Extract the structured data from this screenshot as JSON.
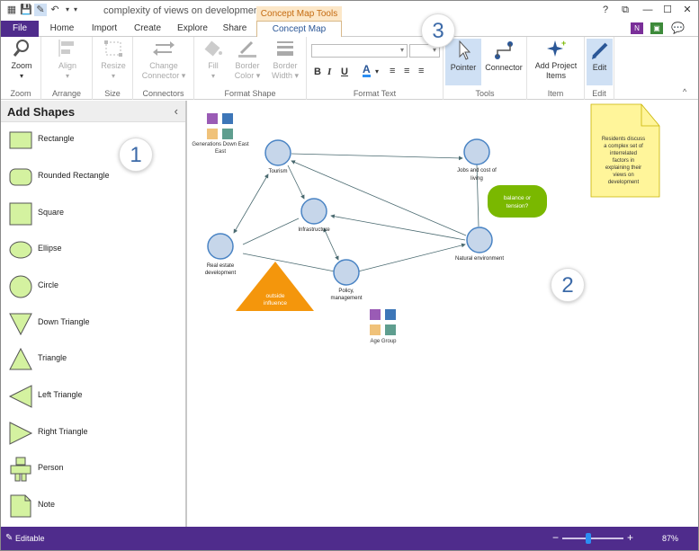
{
  "window": {
    "title": "complexity of views on development",
    "context_tab": "Concept Map Tools",
    "help": "?",
    "controls": [
      "⧉",
      "—",
      "☐",
      "✕"
    ]
  },
  "tabs": [
    {
      "label": "File"
    },
    {
      "label": "Home"
    },
    {
      "label": "Import"
    },
    {
      "label": "Create"
    },
    {
      "label": "Explore"
    },
    {
      "label": "Share"
    },
    {
      "label": "Concept Map"
    }
  ],
  "ribbon": {
    "zoom": {
      "label": "Zoom",
      "group": "Zoom"
    },
    "align": {
      "label": "Align",
      "group": "Arrange"
    },
    "resize": {
      "label": "Resize",
      "group": "Size"
    },
    "change_connector": {
      "label1": "Change",
      "label2": "Connector ▾",
      "group": "Connectors"
    },
    "fill": {
      "label": "Fill"
    },
    "border_color": {
      "label1": "Border",
      "label2": "Color ▾"
    },
    "border_width": {
      "label1": "Border",
      "label2": "Width ▾",
      "group": "Format Shape"
    },
    "format_text": {
      "group": "Format Text",
      "bold": "B",
      "italic": "I",
      "underline": "U",
      "font_color": "A"
    },
    "pointer": {
      "label": "Pointer"
    },
    "connector": {
      "label": "Connector",
      "group": "Tools"
    },
    "add_project_items": {
      "label1": "Add Project",
      "label2": "Items",
      "group": "Item"
    },
    "edit": {
      "label": "Edit",
      "group": "Edit"
    },
    "collapse": "^"
  },
  "badges": {
    "one": "1",
    "two": "2",
    "three": "3"
  },
  "sidebar": {
    "title": "Add Shapes",
    "collapse": "‹",
    "shapes": [
      {
        "label": "Rectangle",
        "icon": "rectangle-icon"
      },
      {
        "label": "Rounded Rectangle",
        "icon": "rounded-rectangle-icon"
      },
      {
        "label": "Square",
        "icon": "square-icon"
      },
      {
        "label": "Ellipse",
        "icon": "ellipse-icon"
      },
      {
        "label": "Circle",
        "icon": "circle-icon"
      },
      {
        "label": "Down Triangle",
        "icon": "down-triangle-icon"
      },
      {
        "label": "Triangle",
        "icon": "triangle-icon"
      },
      {
        "label": "Left Triangle",
        "icon": "left-triangle-icon"
      },
      {
        "label": "Right Triangle",
        "icon": "right-triangle-icon"
      },
      {
        "label": "Person",
        "icon": "person-icon"
      },
      {
        "label": "Note",
        "icon": "note-icon"
      }
    ]
  },
  "canvas": {
    "legend_top": "Generations Down East",
    "legend_bottom": "Age Group",
    "nodes": {
      "tourism": "Tourism",
      "jobs1": "Jobs and cost of",
      "jobs2": "living",
      "infrastructure": "Infrastructure",
      "real_estate1": "Real estate",
      "real_estate2": "development",
      "natural": "Natural environment",
      "policy1": "Policy,",
      "policy2": "management"
    },
    "balance": [
      "balance or",
      "tension?"
    ],
    "outside": [
      "outside",
      "influence"
    ],
    "note": [
      "Residents discuss",
      "a complex set of",
      "interrelated",
      "factors in",
      "explaining their",
      "views on",
      "development"
    ]
  },
  "status": {
    "text": "Editable",
    "zoom": "87%",
    "minus": "−",
    "plus": "+"
  },
  "colors": {
    "accent": "#4f2c8c",
    "node_fill": "#c6d6ea",
    "node_stroke": "#4a84c4",
    "triangle": "#f4960c",
    "balance": "#7ab800",
    "note": "#fff59a",
    "shape_fill": "#d4f2a0"
  }
}
